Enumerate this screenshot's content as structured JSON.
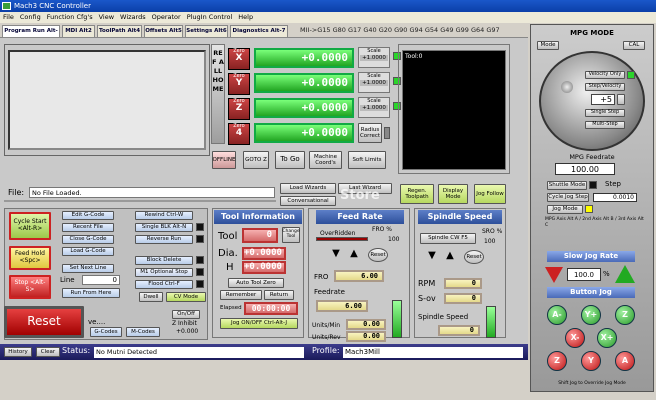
{
  "title": "Mach3 CNC Controller",
  "menu": [
    "File",
    "Config",
    "Function Cfg's",
    "View",
    "Wizards",
    "Operator",
    "PlugIn Control",
    "Help"
  ],
  "tabs": [
    "Program Run Alt-1",
    "MDI Alt2",
    "ToolPath Alt4",
    "Offsets Alt5",
    "Settings Alt6",
    "Diagnostics Alt-7"
  ],
  "gcodes": "MII->G15  G80 G17 G40 G20 G90 G94 G54 G49 G99 G64 G97",
  "refall": "REF ALL HOME",
  "axes": [
    {
      "zero": "Zero",
      "axis": "X",
      "value": "+0.0000",
      "scale": "Scale",
      "scale_val": "+1.0000"
    },
    {
      "zero": "Zero",
      "axis": "Y",
      "value": "+0.0000",
      "scale": "Scale",
      "scale_val": "+1.0000"
    },
    {
      "zero": "Zero",
      "axis": "Z",
      "value": "+0.0000",
      "scale": "Scale",
      "scale_val": "+1.0000"
    },
    {
      "zero": "Zero",
      "axis": "4",
      "value": "+0.0000",
      "radius": "Radius Correct"
    }
  ],
  "dro_buttons": {
    "offline": "OFFLINE",
    "gotoz": "GOTO Z",
    "togo": "To Go",
    "machine": "Machine Coord's",
    "soft": "Soft Limits"
  },
  "toolpath_label": "Tool:0",
  "file": {
    "label": "File:",
    "value": "No File Loaded."
  },
  "wizards": {
    "load": "Load Wizards",
    "last": "Last Wizard",
    "conv": "Conversational",
    "regen": "Regen. Toolpath",
    "display": "Display Mode",
    "jogfollow": "Jog Follow"
  },
  "watermark": "Store",
  "left": {
    "cycle": "Cycle Start <Alt-R>",
    "feedhold": "Feed Hold <Spc>",
    "stop": "Stop <Alt-S>",
    "reset": "Reset"
  },
  "gcode_btns": {
    "edit": "Edit G-Code",
    "recent": "Recent File",
    "close": "Close G-Code",
    "load": "Load G-Code",
    "setnext": "Set Next Line",
    "line_label": "Line",
    "line_val": "0",
    "runfrom": "Run From Here",
    "rewind": "Rewind Ctrl-W",
    "single": "Single BLK Alt-N",
    "reverse": "Reverse Run",
    "block": "Block Delete",
    "m1": "M1 Optional Stop",
    "flood": "Flood Ctrl-F",
    "dwell": "Dwell",
    "cv": "CV Mode"
  },
  "misc": {
    "ve": "ve....",
    "gcodes": "G-Codes",
    "mcodes": "M-Codes",
    "onoff": "On/Off",
    "zinhibit": "Z Inhibit",
    "zinhibit_val": "+0.000"
  },
  "tool": {
    "header": "Tool Information",
    "tool_label": "Tool",
    "tool_val": "0",
    "change": "Change Tool",
    "dia_label": "Dia.",
    "dia_val": "+0.0000",
    "h_label": "H",
    "h_val": "+0.0000",
    "autozero": "Auto Tool Zero",
    "remember": "Remember",
    "return": "Return",
    "elapsed_label": "Elapsed",
    "elapsed": "00:00:00",
    "jog": "Jog ON/OFF Ctrl-Alt-J"
  },
  "feed": {
    "header": "Feed Rate",
    "overridden": "OverRidden",
    "fro_pct_label": "FRO %",
    "fro_pct": "100",
    "reset": "Reset",
    "fro_label": "FRO",
    "fro_val": "6.00",
    "feedrate_label": "Feedrate",
    "feedrate_val": "6.00",
    "units_min": "Units/Min",
    "units_min_val": "0.00",
    "units_rev": "Units/Rev",
    "units_rev_val": "0.00"
  },
  "spindle": {
    "header": "Spindle Speed",
    "cwf5": "Spindle CW F5",
    "sro_label": "SRO %",
    "sro_val": "100",
    "reset": "Reset",
    "rpm_label": "RPM",
    "rpm_val": "0",
    "sov_label": "S-ov",
    "sov_val": "0",
    "speed_label": "Spindle Speed",
    "speed_val": "0"
  },
  "status": {
    "history": "History",
    "clear": "Clear",
    "label": "Status:",
    "value": "No Mutni Detected",
    "profile_label": "Profile:",
    "profile": "Mach3Mill"
  },
  "mpg": {
    "title": "MPG MODE",
    "mode": "Mode",
    "cal": "CAL",
    "velocity": "Velocity Only",
    "stepvel": "Step/Velocity",
    "counter": "+5",
    "single": "Single Step",
    "multi": "Multi-Step",
    "feedrate_label": "MPG Feedrate",
    "feedrate": "100.00",
    "shuttle": "Shuttle Mode",
    "step": "Step",
    "cycle_step": "Cycle Jog Step",
    "cycle_step_val": "0.0010",
    "jogmode": "Jog Mode",
    "axes_labels": "MPG Axis Alt A / 2nd Axis Alt B / 3rd Axis Alt C",
    "slow": "Slow Jog Rate",
    "slow_val": "100.0",
    "pct": "%",
    "button_jog": "Button Jog",
    "hint": "Shift Jog to Override Jog Mode"
  }
}
